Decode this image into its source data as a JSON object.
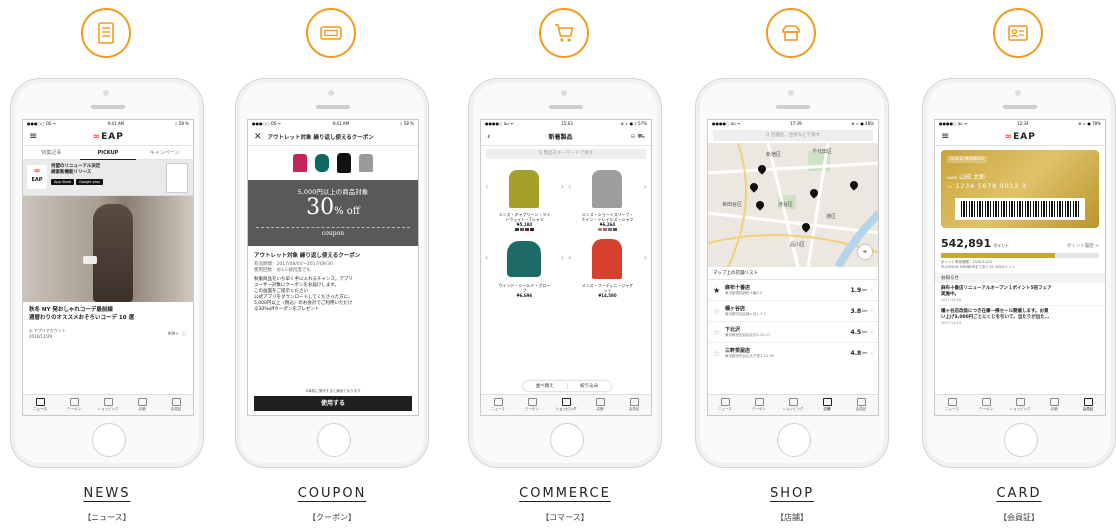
{
  "columns": {
    "news": {
      "caption": "NEWS",
      "caption_jp": "【ニュース】",
      "icon": "document-icon",
      "status": {
        "carrier": "●●●○○ OS ᯤ",
        "time": "9:41 AM",
        "battery": "ᛒ 58 %"
      },
      "logo": "EAP",
      "tabs": [
        "特集記事",
        "PICKUP",
        "キャンペーン"
      ],
      "banner": {
        "text1": "待望のリニューアル決定",
        "text2": "検索新機能リリース",
        "store1": "App Store",
        "store2": "Google play",
        "logo_text": "EAP"
      },
      "article": {
        "title1": "秋冬 NY 発おしゃれコーデ最前線",
        "title2": "週替わりのオススメおそろいコーデ 10 選",
        "account": "◎ アプリアカウント",
        "date": "2016/11/29",
        "likes": "999+"
      }
    },
    "coupon": {
      "caption": "COUPON",
      "caption_jp": "【クーポン】",
      "icon": "ticket-icon",
      "status": {
        "carrier": "●●●○○ OS ᯤ",
        "time": "9:41 AM",
        "battery": "ᛒ 58 %"
      },
      "nav_title": "アウトレット対象 繰り返し使えるクーポン",
      "hero": {
        "line1": "5,000円以上の商品対象",
        "big": "30",
        "pct": "% off",
        "word": "coupon"
      },
      "title": "アウトレット対象 繰り返し使えるクーポン",
      "validity": "有効期間：2017/08/01〜2017/09/30",
      "usage": "使用回数：お1人様何度でも",
      "body": [
        "秋服商品をいち早く手に入れるチャンス。アプリ",
        "ユーザー対象にクーポンをお届けします。",
        "この画面をご提示ください",
        "公式アプリをダウンロードしてくださった方に、",
        "5,000円以上（税込）のお会計でご利用いただけ",
        "る30%offクーポンをプレゼント"
      ],
      "note": "※事前に操作すると無効となります",
      "button": "使用する"
    },
    "commerce": {
      "caption": "COMMERCE",
      "caption_jp": "【コマース】",
      "icon": "cart-icon",
      "status": {
        "carrier": "●●●●○ au ᯤ",
        "time": "15:03",
        "battery": "⊕ ➶ ● ᛒ 57%"
      },
      "nav_title": "新着製品",
      "search_placeholder": "Q 製品をキーワードで探す",
      "products": [
        {
          "name1": "メンズ・キャプリーン・ライ",
          "name2": "トウェイト・Tシャツ",
          "price": "¥5,184"
        },
        {
          "name1": "メンズ・ショートスリーブ・",
          "name2": "ナイン・トレイルズ・シャツ",
          "price": "¥6,264"
        },
        {
          "name1": "ウインド・シールド・グロー",
          "name2": "ブ",
          "price": "¥6,696"
        },
        {
          "name1": "メンズ・フーディニ・ジャケ",
          "name2": "ット",
          "price": "¥14,580"
        }
      ],
      "sort": "並べ替え",
      "filter": "絞り込み",
      "colors": {
        "shirt": "#a4a02a",
        "tee": "#9d9d9d",
        "glove": "#1f6b68",
        "jacket": "#d8402e"
      }
    },
    "shop": {
      "caption": "SHOP",
      "caption_jp": "【店舗】",
      "icon": "shop-icon",
      "status": {
        "carrier": "●●●●○ au ᯤ",
        "time": "17:39",
        "battery": "⊕ ➶ ● 48%"
      },
      "search_placeholder": "Q 店舗名、住所などで探す",
      "map_labels": [
        "新宿区",
        "千代田区",
        "世田谷区",
        "渋谷区",
        "品川区",
        "港区"
      ],
      "list_title": "マップ上の店舗リスト",
      "stores": [
        {
          "name": "麻布十番店",
          "addr": "東京都港区麻布十番2-5",
          "dist": "1.9",
          "unit": "km"
        },
        {
          "name": "幡ヶ谷店",
          "addr": "東京都渋谷区幡ヶ谷1-3-1",
          "dist": "3.8",
          "unit": "km"
        },
        {
          "name": "下北沢",
          "addr": "東京都世田谷区北沢2-20-17",
          "dist": "4.5",
          "unit": "km"
        },
        {
          "name": "三軒茶屋店",
          "addr": "東京都世田谷区太子堂1-14-16",
          "dist": "4.8",
          "unit": "km"
        }
      ]
    },
    "card": {
      "caption": "CARD",
      "caption_jp": "【会員証】",
      "icon": "member-card-icon",
      "status": {
        "carrier": "●●●●○ au ᯤ",
        "time": "12:34",
        "battery": "⊕ ➶ ● 78%"
      },
      "logo": "EAP",
      "badge": "GOLD MEMBER",
      "name_label": "NAME",
      "name": "山田 太郎",
      "id_label": "ID",
      "number": "1234 5678 9012 3",
      "points": "542,891",
      "points_unit": "ポイント",
      "history": "ポイント履歴 >",
      "expiry": "ポイント有効期限：2020/12/31",
      "platinum": "PLATINUM MEMBERまであと19,345ポイント",
      "news_header": "お知らせ",
      "news": [
        {
          "t1": "麻布十番店リニューアルオープン１ポイント5倍フェア",
          "t2": "実施中。",
          "date": "2017/11/29"
        },
        {
          "t1": "幡ヶ谷店改装につき在庫一掃セール開催します。お買",
          "t2": "い上げ3,000円ごとにくじを引いて、当たりが出た…",
          "date": "2017/11/15"
        }
      ],
      "progress": 0.72,
      "gold": "#c9a53a"
    }
  },
  "tab_labels": [
    "ニュース",
    "クーポン",
    "ショッピング",
    "店舗",
    "会員証"
  ],
  "accent": "#f29a1e"
}
